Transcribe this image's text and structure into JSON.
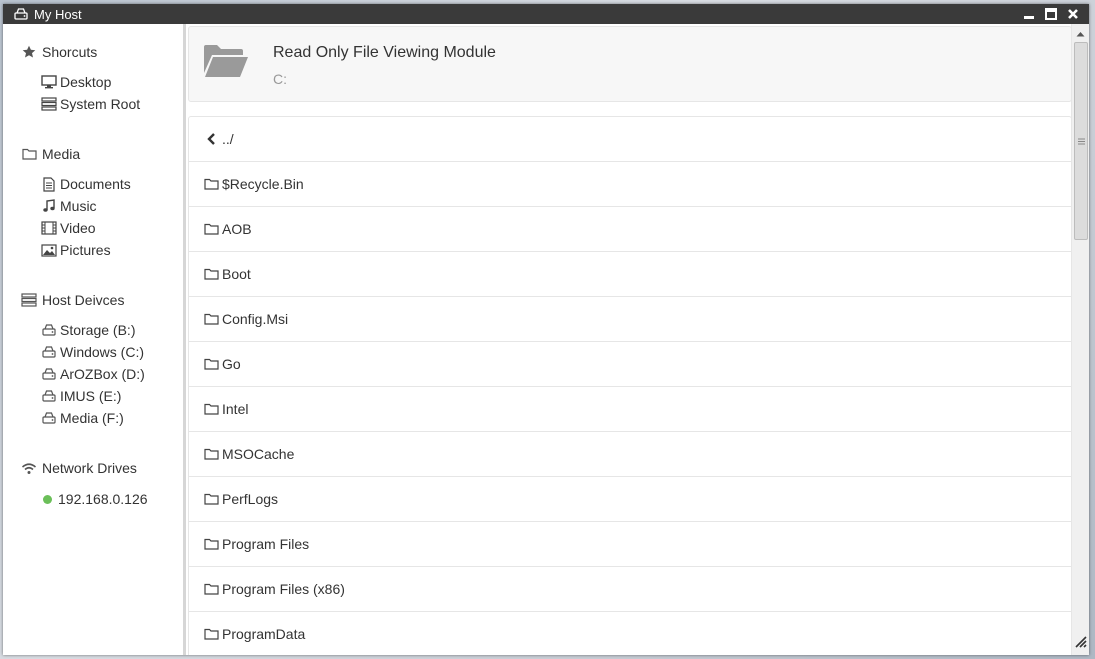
{
  "window": {
    "title": "My Host"
  },
  "sidebar": {
    "shortcuts": {
      "label": "Shorcuts",
      "items": [
        {
          "label": "Desktop"
        },
        {
          "label": "System Root"
        }
      ]
    },
    "media": {
      "label": "Media",
      "items": [
        {
          "label": "Documents"
        },
        {
          "label": "Music"
        },
        {
          "label": "Video"
        },
        {
          "label": "Pictures"
        }
      ]
    },
    "host_devices": {
      "label": "Host Deivces",
      "items": [
        {
          "label": "Storage (B:)"
        },
        {
          "label": "Windows (C:)"
        },
        {
          "label": "ArOZBox (D:)"
        },
        {
          "label": "IMUS (E:)"
        },
        {
          "label": "Media (F:)"
        }
      ]
    },
    "network": {
      "label": "Network Drives",
      "items": [
        {
          "label": "192.168.0.126"
        }
      ]
    }
  },
  "header": {
    "title": "Read Only File Viewing Module",
    "path": "C:"
  },
  "files": {
    "parent": "../",
    "items": [
      {
        "name": "$Recycle.Bin"
      },
      {
        "name": "AOB"
      },
      {
        "name": "Boot"
      },
      {
        "name": "Config.Msi"
      },
      {
        "name": "Go"
      },
      {
        "name": "Intel"
      },
      {
        "name": "MSOCache"
      },
      {
        "name": "PerfLogs"
      },
      {
        "name": "Program Files"
      },
      {
        "name": "Program Files (x86)"
      },
      {
        "name": "ProgramData"
      }
    ]
  },
  "colors": {
    "titlebar": "#3a3a3a",
    "network_status": "#6bbf59",
    "accent_text": "#333333"
  }
}
